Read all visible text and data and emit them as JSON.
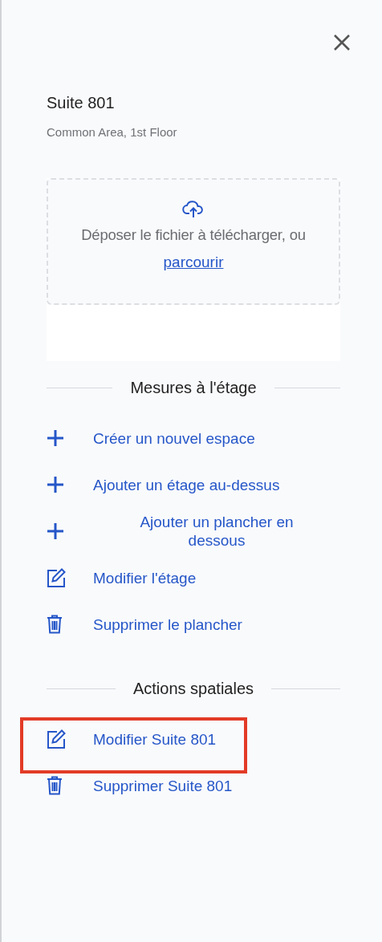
{
  "panel": {
    "title": "Suite 801",
    "subtitle": "Common Area, 1st Floor"
  },
  "upload": {
    "prompt": "Déposer le fichier à télécharger, ou",
    "link": "parcourir"
  },
  "sections": [
    {
      "heading": "Mesures à l'étage",
      "actions": [
        {
          "kind": "add",
          "label": "Créer un nouvel espace",
          "centered": false,
          "highlighted": false
        },
        {
          "kind": "add",
          "label": "Ajouter un étage au-dessus",
          "centered": false,
          "highlighted": false
        },
        {
          "kind": "add",
          "label": "Ajouter un plancher en dessous",
          "centered": true,
          "highlighted": false
        },
        {
          "kind": "edit",
          "label": "Modifier l'étage",
          "centered": false,
          "highlighted": false
        },
        {
          "kind": "delete",
          "label": "Supprimer le plancher",
          "centered": false,
          "highlighted": false
        }
      ]
    },
    {
      "heading": "Actions spatiales",
      "actions": [
        {
          "kind": "edit",
          "label": "Modifier Suite 801",
          "centered": false,
          "highlighted": true
        },
        {
          "kind": "delete",
          "label": "Supprimer Suite 801",
          "centered": false,
          "highlighted": false
        }
      ]
    }
  ]
}
